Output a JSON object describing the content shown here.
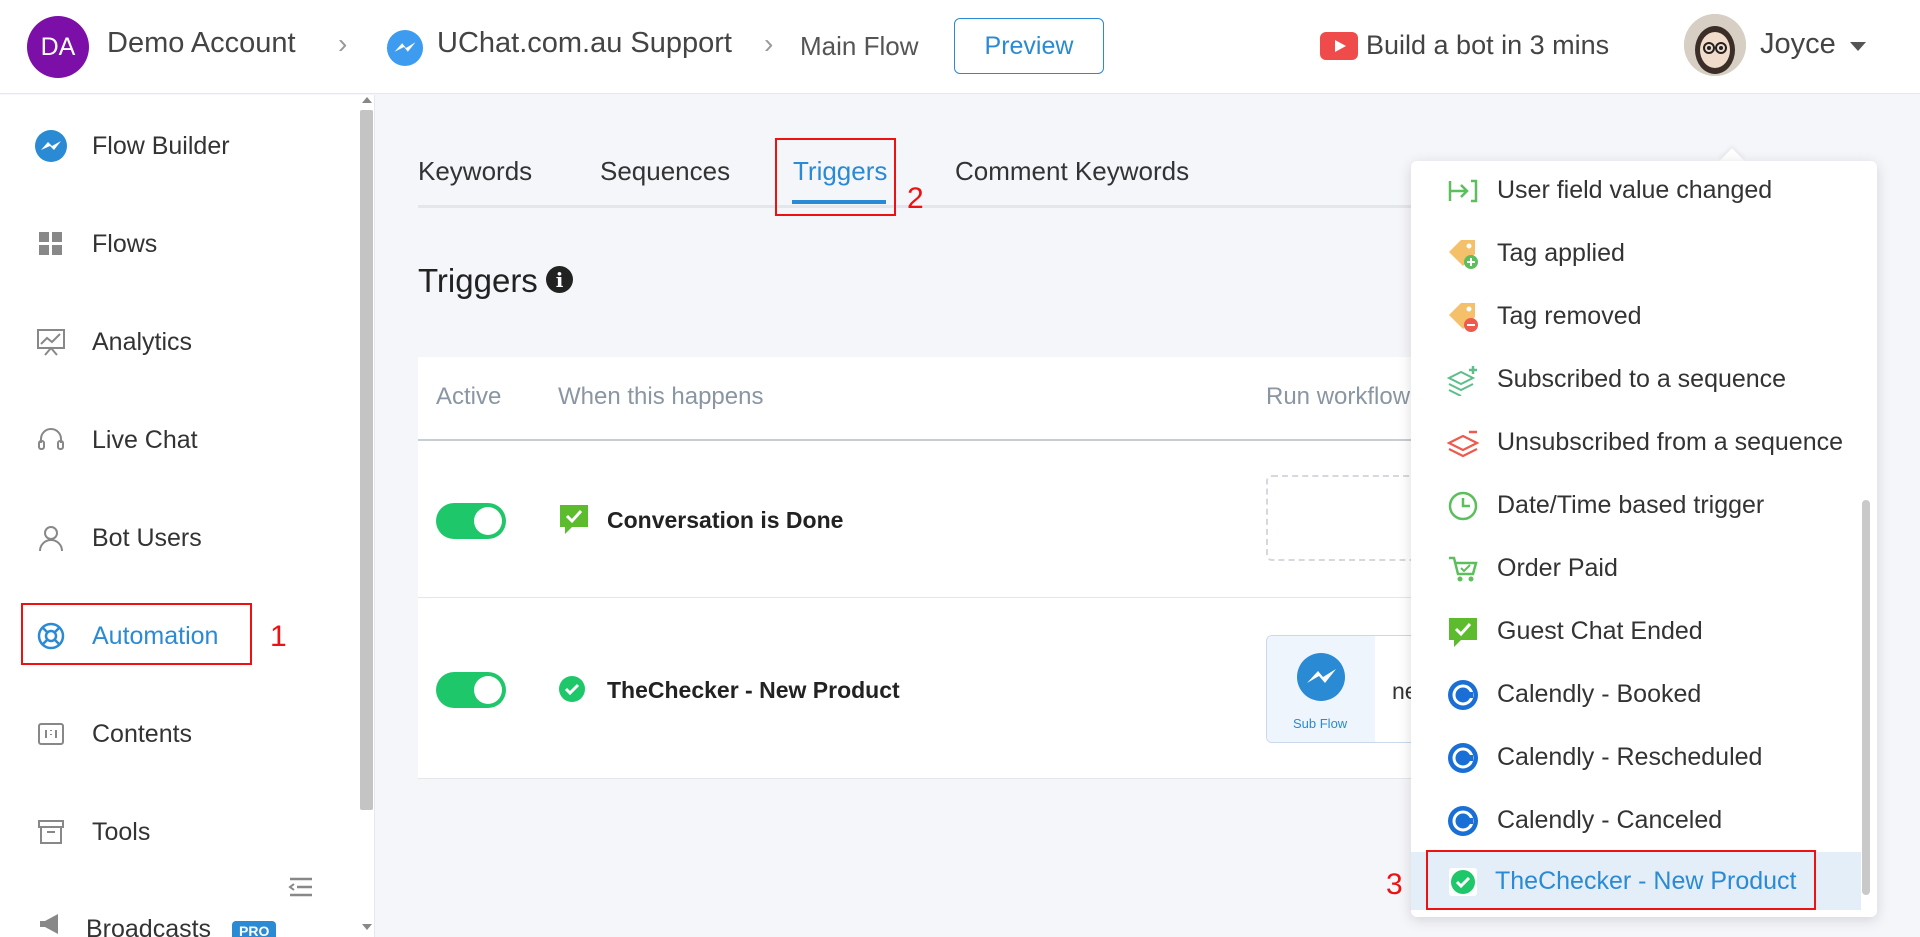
{
  "header": {
    "account_initials": "DA",
    "account_name": "Demo Account",
    "bot_name": "UChat.com.au Support",
    "flow_name": "Main Flow",
    "preview_label": "Preview",
    "build_bot_label": "Build a bot in 3 mins",
    "user_name": "Joyce"
  },
  "sidebar": {
    "items": [
      {
        "label": "Flow Builder",
        "icon": "messenger-icon"
      },
      {
        "label": "Flows",
        "icon": "grid-icon"
      },
      {
        "label": "Analytics",
        "icon": "chart-icon"
      },
      {
        "label": "Live Chat",
        "icon": "headset-icon"
      },
      {
        "label": "Bot Users",
        "icon": "user-icon"
      },
      {
        "label": "Automation",
        "icon": "lifebuoy-icon",
        "active": true
      },
      {
        "label": "Contents",
        "icon": "contents-icon"
      },
      {
        "label": "Tools",
        "icon": "archive-icon"
      },
      {
        "label": "Broadcasts",
        "icon": "megaphone-icon",
        "badge": "PRO"
      }
    ]
  },
  "tabs": {
    "keywords": "Keywords",
    "sequences": "Sequences",
    "triggers": "Triggers",
    "comment_keywords": "Comment Keywords"
  },
  "section_title": "Triggers",
  "table": {
    "headers": {
      "active": "Active",
      "when": "When this happens",
      "run": "Run workflow"
    },
    "rows": [
      {
        "label": "Conversation is Done",
        "active": true
      },
      {
        "label": "TheChecker - New Product",
        "active": true,
        "workflow_type": "Sub Flow",
        "workflow_text": "ne"
      }
    ]
  },
  "dropdown": {
    "items": [
      "User field value changed",
      "Tag applied",
      "Tag removed",
      "Subscribed to a sequence",
      "Unsubscribed from a sequence",
      "Date/Time based trigger",
      "Order Paid",
      "Guest Chat Ended",
      "Calendly - Booked",
      "Calendly - Rescheduled",
      "Calendly - Canceled",
      "TheChecker - New Product"
    ],
    "selected_index": 11
  },
  "annotations": [
    "1",
    "2",
    "3"
  ],
  "colors": {
    "accent": "#2a8ad4",
    "toggle_on": "#1ec76a",
    "annotation": "#e11111",
    "account_avatar": "#7b0fa8"
  }
}
